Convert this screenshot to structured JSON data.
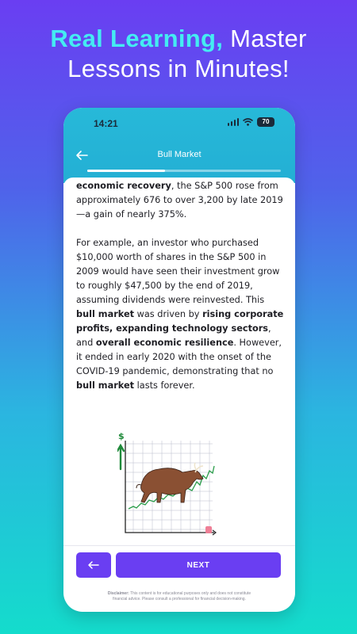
{
  "headline": {
    "accent": "Real Learning,",
    "rest": " Master",
    "line2": "Lessons in Minutes!"
  },
  "status_bar": {
    "time": "14:21",
    "battery": "70"
  },
  "lesson": {
    "title": "Bull Market",
    "progress_fraction": 0.4
  },
  "content": {
    "p1": {
      "bold1": "economic recovery",
      "text1": ", the S&P 500 rose from approximately 676 to over 3,200 by late 2019—a gain of nearly 375%."
    },
    "p2": {
      "text1": "For example, an investor who purchased $10,000 worth of shares in the S&P 500 in 2009 would have seen their investment grow to roughly $47,500 by the end of 2019, assuming dividends were reinvested. This ",
      "bold1": "bull market",
      "text2": " was driven by ",
      "bold2": "rising corporate profits, expanding technology sectors",
      "text3": ", and ",
      "bold3": "overall economic resilience",
      "text4": ". However, it ended in early 2020 with the onset of the COVID-19 pandemic, demonstrating that no ",
      "bold4": "bull market",
      "text5": " lasts forever."
    }
  },
  "footer": {
    "next_label": "NEXT",
    "disclaimer_label": "Disclaimer:",
    "disclaimer_line1": " This content is for educational purposes only and does not constitute",
    "disclaimer_line2": "financial advice. Please consult a professional for financial decision-making."
  },
  "colors": {
    "primary": "#6a3ef2",
    "header": "#27b9d9",
    "accent_text": "#44ecf2"
  },
  "icons": {
    "back": "back-arrow-icon",
    "signal": "signal-icon",
    "wifi": "wifi-icon",
    "battery": "battery-icon",
    "illustration": "bull-market-chart-illustration"
  }
}
